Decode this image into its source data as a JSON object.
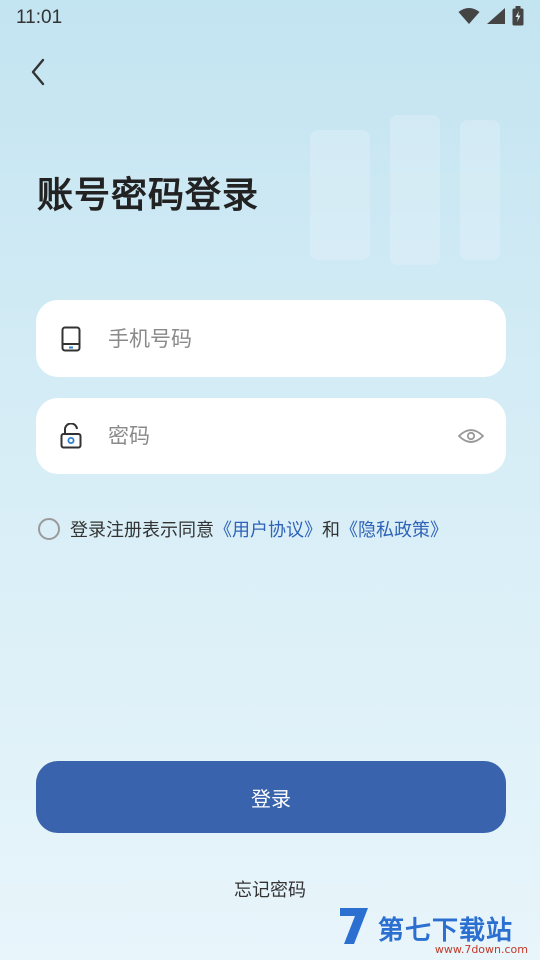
{
  "status_bar": {
    "time": "11:01",
    "icons": [
      "wifi-icon",
      "signal-icon",
      "battery-icon"
    ]
  },
  "page": {
    "back_icon": "chevron-left-icon",
    "title": "账号密码登录"
  },
  "form": {
    "phone": {
      "icon": "phone-icon",
      "placeholder": "手机号码",
      "value": ""
    },
    "password": {
      "icon": "lock-icon",
      "placeholder": "密码",
      "value": "",
      "toggle_icon": "eye-icon"
    }
  },
  "agreement": {
    "text": "登录注册表示同意",
    "user_agreement": "《用户协议》",
    "and": "和",
    "privacy_policy": "《隐私政策》",
    "checked": false
  },
  "actions": {
    "login_label": "登录",
    "forgot_label": "忘记密码"
  },
  "watermark": {
    "name": "第七下载站",
    "url": "www.7down.com"
  },
  "colors": {
    "accent": "#3a63ad",
    "link": "#2f63b8",
    "background_top": "#c3e4f1",
    "background_bottom": "#e8f5fb"
  }
}
